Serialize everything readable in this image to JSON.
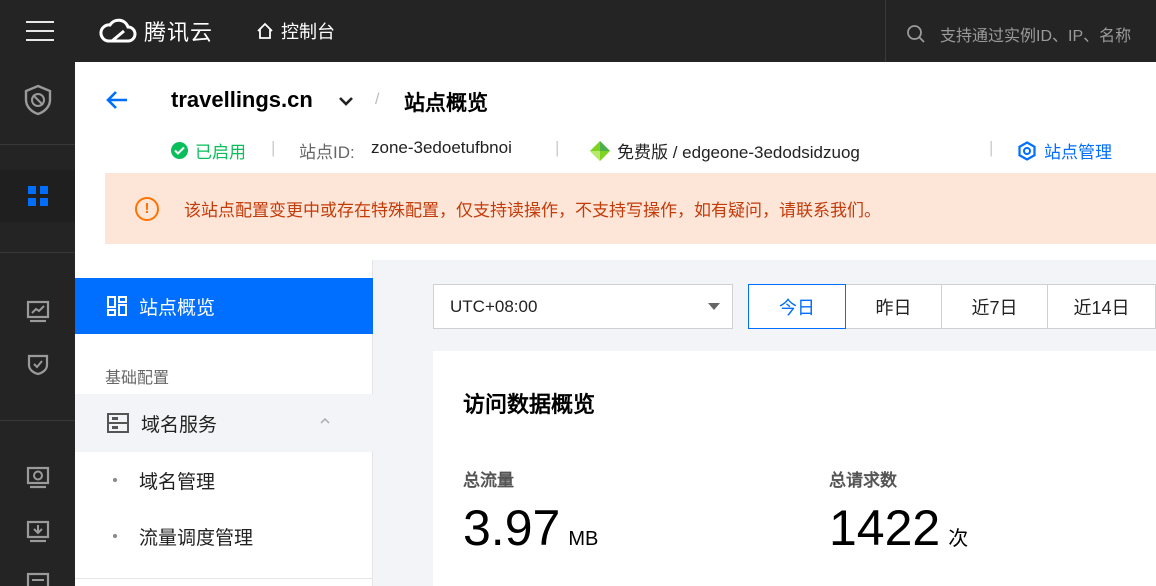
{
  "topbar": {
    "brand": "腾讯云",
    "console_label": "控制台",
    "search_placeholder": "支持通过实例ID、IP、名称"
  },
  "site": {
    "domain": "travellings.cn",
    "separator": "/",
    "page_title": "站点概览",
    "status": "已启用",
    "site_id_label": "站点ID:",
    "site_id": "zone-3edoetufbnoi",
    "plan": "免费版 / edgeone-3edodsidzuog",
    "manage_label": "站点管理",
    "pipe": "|"
  },
  "alert": {
    "icon_glyph": "!",
    "message": "该站点配置变更中或存在特殊配置，仅支持读操作，不支持写操作，如有疑问，请联系我们。"
  },
  "sidenav": {
    "active_label": "站点概览",
    "group_label": "基础配置",
    "domain_service_label": "域名服务",
    "sub_items": [
      "域名管理",
      "流量调度管理"
    ]
  },
  "toolbar": {
    "timezone": "UTC+08:00",
    "ranges": [
      "今日",
      "昨日",
      "近7日",
      "近14日"
    ],
    "active_range": 0
  },
  "overview": {
    "title": "访问数据概览",
    "metrics": [
      {
        "label": "总流量",
        "value": "3.97",
        "unit": "MB"
      },
      {
        "label": "总请求数",
        "value": "1422",
        "unit": "次"
      }
    ]
  },
  "colors": {
    "accent": "#006eff",
    "success": "#0abf5b",
    "warning": "#ff7200",
    "topbar_bg": "#242424"
  }
}
